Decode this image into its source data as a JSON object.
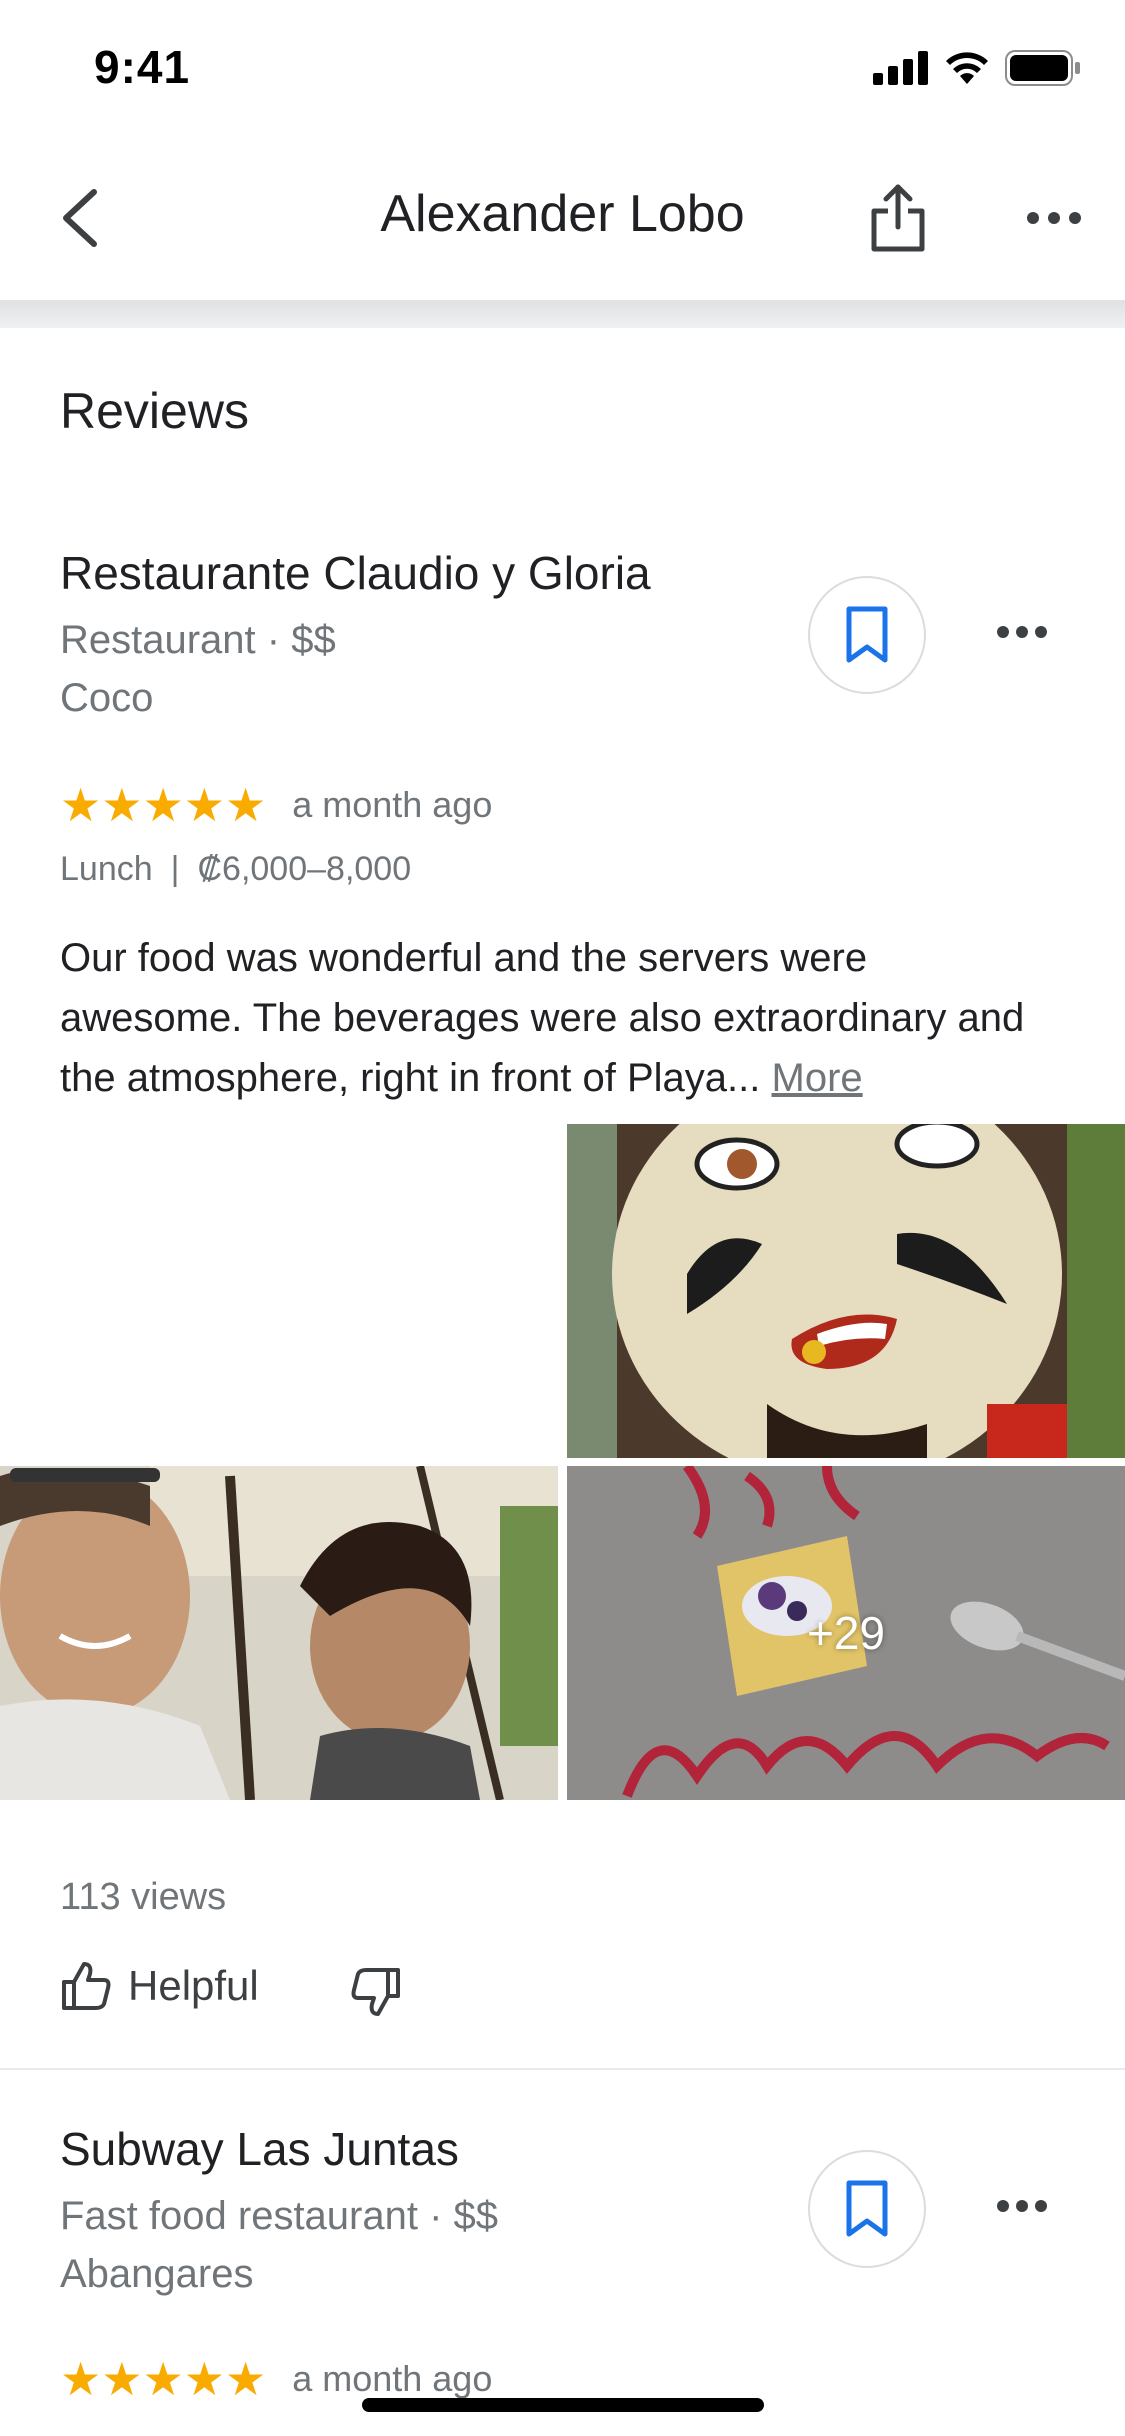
{
  "status_bar": {
    "time": "9:41"
  },
  "header": {
    "title": "Alexander Lobo"
  },
  "section": {
    "title": "Reviews"
  },
  "reviews": [
    {
      "place_name": "Restaurante Claudio y Gloria",
      "category": "Restaurant · $$",
      "location": "Coco",
      "rating": 5,
      "stars": "★★★★★",
      "date": "a month ago",
      "meal": "Lunch",
      "separator": "|",
      "price": "₡6,000–8,000",
      "text": "Our food was wonderful and the servers were awesome. The beverages were also extraordinary and the atmosphere, right in front of Playa...",
      "more_label": "More",
      "photo_count": "+29",
      "views": "113 views",
      "helpful_label": "Helpful"
    },
    {
      "place_name": "Subway Las Juntas",
      "category": "Fast food restaurant · $$",
      "location": "Abangares",
      "rating": 5,
      "stars": "★★★★★",
      "date": "a month ago"
    }
  ],
  "colors": {
    "star": "#f9ab00",
    "accent_blue": "#1a73e8",
    "secondary_text": "#70757a",
    "primary_text": "#202124"
  },
  "icons": {
    "back": "chevron-left-icon",
    "share": "share-icon",
    "more": "more-horizontal-icon",
    "save": "bookmark-icon",
    "helpful": "thumbs-up-icon",
    "not_helpful": "thumbs-down-icon"
  }
}
